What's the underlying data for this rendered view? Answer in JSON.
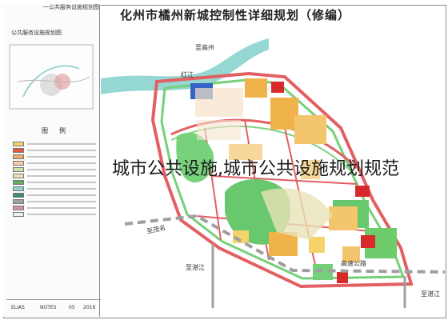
{
  "page": {
    "main_title": "化州市橘州新城控制性详细规划（修编）",
    "side_title": "公共服务设施规划图",
    "side_corner_label": "一公共服务设施规划图",
    "legend_heading": "图例",
    "overlay_caption": "城市公共设施,城市公共设施规划规范",
    "footer_cells": [
      "ELIAS",
      "NOTES",
      "05",
      "2016"
    ]
  },
  "map_labels": {
    "north_road": "至高州",
    "river_label": "红江",
    "west_road": "至茂名",
    "south_road_west": "至湛江",
    "south_road_east": "至湛江",
    "district_east": "高速公路"
  },
  "legend": {
    "colors": [
      "#f6d36a",
      "#e3573f",
      "#f3a86a",
      "#f8c8a8",
      "#c8e7a5",
      "#e9e2b8",
      "#5fae5c",
      "#8fd1cf",
      "#3e8c6a",
      "#a0a0a0",
      "#d88ab5",
      "#f0f0f0"
    ]
  },
  "colors": {
    "green": "#69c86d",
    "water": "#8fd6d1",
    "road": "#e25f63",
    "orange": "#f0b24a",
    "red": "#d82a2a",
    "blue": "#3563c6"
  }
}
